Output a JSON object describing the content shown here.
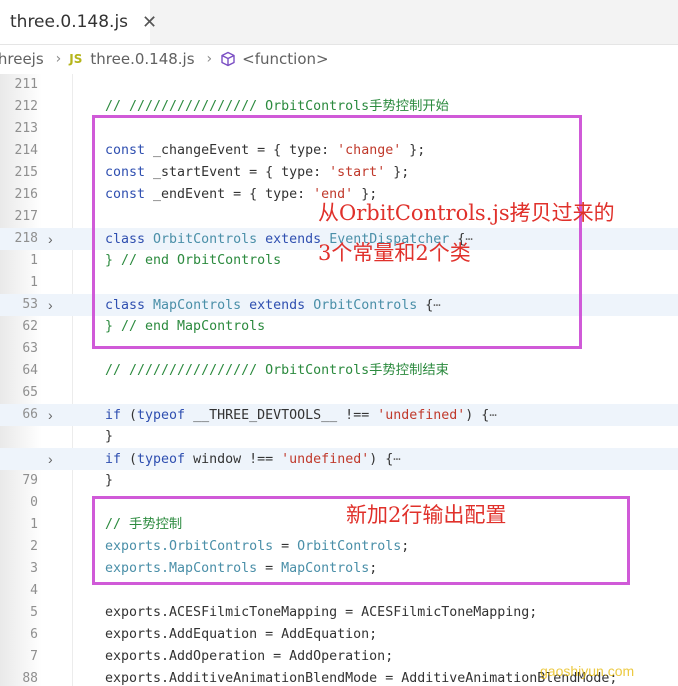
{
  "tab": {
    "title": "three.0.148.js",
    "close": "✕"
  },
  "breadcrumb": {
    "folder": "threejs",
    "file_badge": "JS",
    "file": "three.0.148.js",
    "symbol": "<function>"
  },
  "lines": [
    {
      "ln": "211",
      "fold": "",
      "hl": false,
      "parts": []
    },
    {
      "ln": "212",
      "fold": "",
      "hl": false,
      "parts": [
        {
          "t": "// //////////////// OrbitControls手势控制开始",
          "c": "c-comment"
        }
      ]
    },
    {
      "ln": "213",
      "fold": "",
      "hl": false,
      "parts": []
    },
    {
      "ln": "214",
      "fold": "",
      "hl": false,
      "parts": [
        {
          "t": "const",
          "c": "c-kw"
        },
        {
          "t": " _changeEvent = { type: ",
          "c": "c-plain"
        },
        {
          "t": "'change'",
          "c": "c-str"
        },
        {
          "t": " };",
          "c": "c-plain"
        }
      ]
    },
    {
      "ln": "215",
      "fold": "",
      "hl": false,
      "parts": [
        {
          "t": "const",
          "c": "c-kw"
        },
        {
          "t": " _startEvent = { type: ",
          "c": "c-plain"
        },
        {
          "t": "'start'",
          "c": "c-str"
        },
        {
          "t": " };",
          "c": "c-plain"
        }
      ]
    },
    {
      "ln": "216",
      "fold": "",
      "hl": false,
      "parts": [
        {
          "t": "const",
          "c": "c-kw"
        },
        {
          "t": " _endEvent = { type: ",
          "c": "c-plain"
        },
        {
          "t": "'end'",
          "c": "c-str"
        },
        {
          "t": " };",
          "c": "c-plain"
        }
      ]
    },
    {
      "ln": "217",
      "fold": "",
      "hl": false,
      "parts": []
    },
    {
      "ln": "218",
      "fold": "›",
      "hl": true,
      "parts": [
        {
          "t": "class",
          "c": "c-kw"
        },
        {
          "t": " ",
          "c": "c-plain"
        },
        {
          "t": "OrbitControls",
          "c": "c-cls"
        },
        {
          "t": " ",
          "c": "c-plain"
        },
        {
          "t": "extends",
          "c": "c-kw"
        },
        {
          "t": " ",
          "c": "c-plain"
        },
        {
          "t": "EventDispatcher",
          "c": "c-cls"
        },
        {
          "t": " {",
          "c": "c-plain"
        },
        {
          "t": "⋯",
          "c": "c-ell"
        }
      ]
    },
    {
      "ln": "1",
      "fold": "",
      "hl": false,
      "parts": [
        {
          "t": "} // end OrbitControls",
          "c": "c-comment"
        }
      ]
    },
    {
      "ln": "1",
      "fold": "",
      "hl": false,
      "parts": []
    },
    {
      "ln": "53",
      "fold": "›",
      "hl": true,
      "parts": [
        {
          "t": "class",
          "c": "c-kw"
        },
        {
          "t": " ",
          "c": "c-plain"
        },
        {
          "t": "MapControls",
          "c": "c-cls"
        },
        {
          "t": " ",
          "c": "c-plain"
        },
        {
          "t": "extends",
          "c": "c-kw"
        },
        {
          "t": " ",
          "c": "c-plain"
        },
        {
          "t": "OrbitControls",
          "c": "c-cls"
        },
        {
          "t": " {",
          "c": "c-plain"
        },
        {
          "t": "⋯",
          "c": "c-ell"
        }
      ]
    },
    {
      "ln": "62",
      "fold": "",
      "hl": false,
      "parts": [
        {
          "t": "} // end MapControls",
          "c": "c-comment"
        }
      ]
    },
    {
      "ln": "63",
      "fold": "",
      "hl": false,
      "parts": []
    },
    {
      "ln": "64",
      "fold": "",
      "hl": false,
      "parts": [
        {
          "t": "// //////////////// OrbitControls手势控制结束",
          "c": "c-comment"
        }
      ]
    },
    {
      "ln": "65",
      "fold": "",
      "hl": false,
      "parts": []
    },
    {
      "ln": "66",
      "fold": "›",
      "hl": true,
      "parts": [
        {
          "t": "if",
          "c": "c-kw"
        },
        {
          "t": " (",
          "c": "c-plain"
        },
        {
          "t": "typeof",
          "c": "c-kw"
        },
        {
          "t": " __THREE_DEVTOOLS__ !== ",
          "c": "c-plain"
        },
        {
          "t": "'undefined'",
          "c": "c-str"
        },
        {
          "t": ") {",
          "c": "c-plain"
        },
        {
          "t": "⋯",
          "c": "c-ell"
        }
      ]
    },
    {
      "ln": "",
      "fold": "",
      "hl": false,
      "parts": [
        {
          "t": "}",
          "c": "c-plain"
        }
      ]
    },
    {
      "ln": "",
      "fold": "›",
      "hl": true,
      "parts": [
        {
          "t": "if",
          "c": "c-kw"
        },
        {
          "t": " (",
          "c": "c-plain"
        },
        {
          "t": "typeof",
          "c": "c-kw"
        },
        {
          "t": " window !== ",
          "c": "c-plain"
        },
        {
          "t": "'undefined'",
          "c": "c-str"
        },
        {
          "t": ") {",
          "c": "c-plain"
        },
        {
          "t": "⋯",
          "c": "c-ell"
        }
      ]
    },
    {
      "ln": "79",
      "fold": "",
      "hl": false,
      "parts": [
        {
          "t": "}",
          "c": "c-plain"
        }
      ]
    },
    {
      "ln": "0",
      "fold": "",
      "hl": false,
      "parts": []
    },
    {
      "ln": "1",
      "fold": "",
      "hl": false,
      "parts": [
        {
          "t": "// 手势控制",
          "c": "c-comment"
        }
      ]
    },
    {
      "ln": "2",
      "fold": "",
      "hl": false,
      "parts": [
        {
          "t": "exports.",
          "c": "c-prop"
        },
        {
          "t": "OrbitControls",
          "c": "c-cls"
        },
        {
          "t": " = ",
          "c": "c-plain"
        },
        {
          "t": "OrbitControls",
          "c": "c-cls"
        },
        {
          "t": ";",
          "c": "c-plain"
        }
      ]
    },
    {
      "ln": "3",
      "fold": "",
      "hl": false,
      "parts": [
        {
          "t": "exports.",
          "c": "c-prop"
        },
        {
          "t": "MapControls",
          "c": "c-cls"
        },
        {
          "t": " = ",
          "c": "c-plain"
        },
        {
          "t": "MapControls",
          "c": "c-cls"
        },
        {
          "t": ";",
          "c": "c-plain"
        }
      ]
    },
    {
      "ln": "4",
      "fold": "",
      "hl": false,
      "parts": []
    },
    {
      "ln": "5",
      "fold": "",
      "hl": false,
      "parts": [
        {
          "t": "exports.ACESFilmicToneMapping = ACESFilmicToneMapping;",
          "c": "c-plain"
        }
      ]
    },
    {
      "ln": "6",
      "fold": "",
      "hl": false,
      "parts": [
        {
          "t": "exports.AddEquation = AddEquation;",
          "c": "c-plain"
        }
      ]
    },
    {
      "ln": "7",
      "fold": "",
      "hl": false,
      "parts": [
        {
          "t": "exports.AddOperation = AddOperation;",
          "c": "c-plain"
        }
      ]
    },
    {
      "ln": "88",
      "fold": "",
      "hl": false,
      "parts": [
        {
          "t": "exports.AdditiveAnimationBlendMode = AdditiveAnimationBlendMode;",
          "c": "c-plain"
        }
      ]
    }
  ],
  "annotations": {
    "top_note_line1": "从OrbitControls.js拷贝过来的",
    "top_note_line2": "3个常量和2个类",
    "bottom_note": "新加2行输出配置"
  },
  "watermark": "gaoshiyun.com",
  "colors": {
    "annotation_border": "#d05ad8",
    "annotation_text": "#e0312b",
    "comment": "#2b8a3e",
    "keyword": "#2f4fb0",
    "string": "#c0392b"
  }
}
